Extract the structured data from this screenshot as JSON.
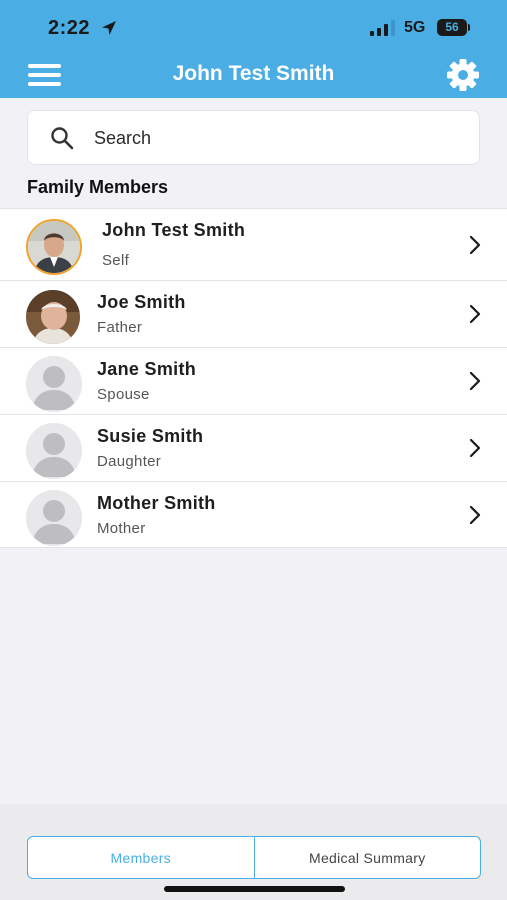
{
  "status_bar": {
    "time": "2:22",
    "network": "5G",
    "battery": "56",
    "location_icon": "location-arrow-icon",
    "signal_icon": "cellular-signal-icon"
  },
  "header": {
    "title": "John Test Smith",
    "menu_icon": "hamburger-menu-icon",
    "settings_icon": "gear-icon",
    "background_color": "#4aaee4"
  },
  "search": {
    "placeholder": "Search",
    "value": "",
    "icon": "search-icon"
  },
  "section_title": "Family Members",
  "members": [
    {
      "name": "John Test Smith",
      "relation": "Self",
      "avatar": "photo-young-man",
      "highlighted": true
    },
    {
      "name": "Joe Smith",
      "relation": "Father",
      "avatar": "photo-older-man"
    },
    {
      "name": "Jane Smith",
      "relation": "Spouse",
      "avatar": "placeholder-person-icon"
    },
    {
      "name": "Susie Smith",
      "relation": "Daughter",
      "avatar": "placeholder-person-icon"
    },
    {
      "name": "Mother Smith",
      "relation": "Mother",
      "avatar": "placeholder-person-icon"
    }
  ],
  "tabs": [
    {
      "label": "Members",
      "active": true
    },
    {
      "label": "Medical Summary",
      "active": false
    }
  ],
  "colors": {
    "accent": "#4aaee4",
    "highlight_ring": "#f0a32a"
  }
}
